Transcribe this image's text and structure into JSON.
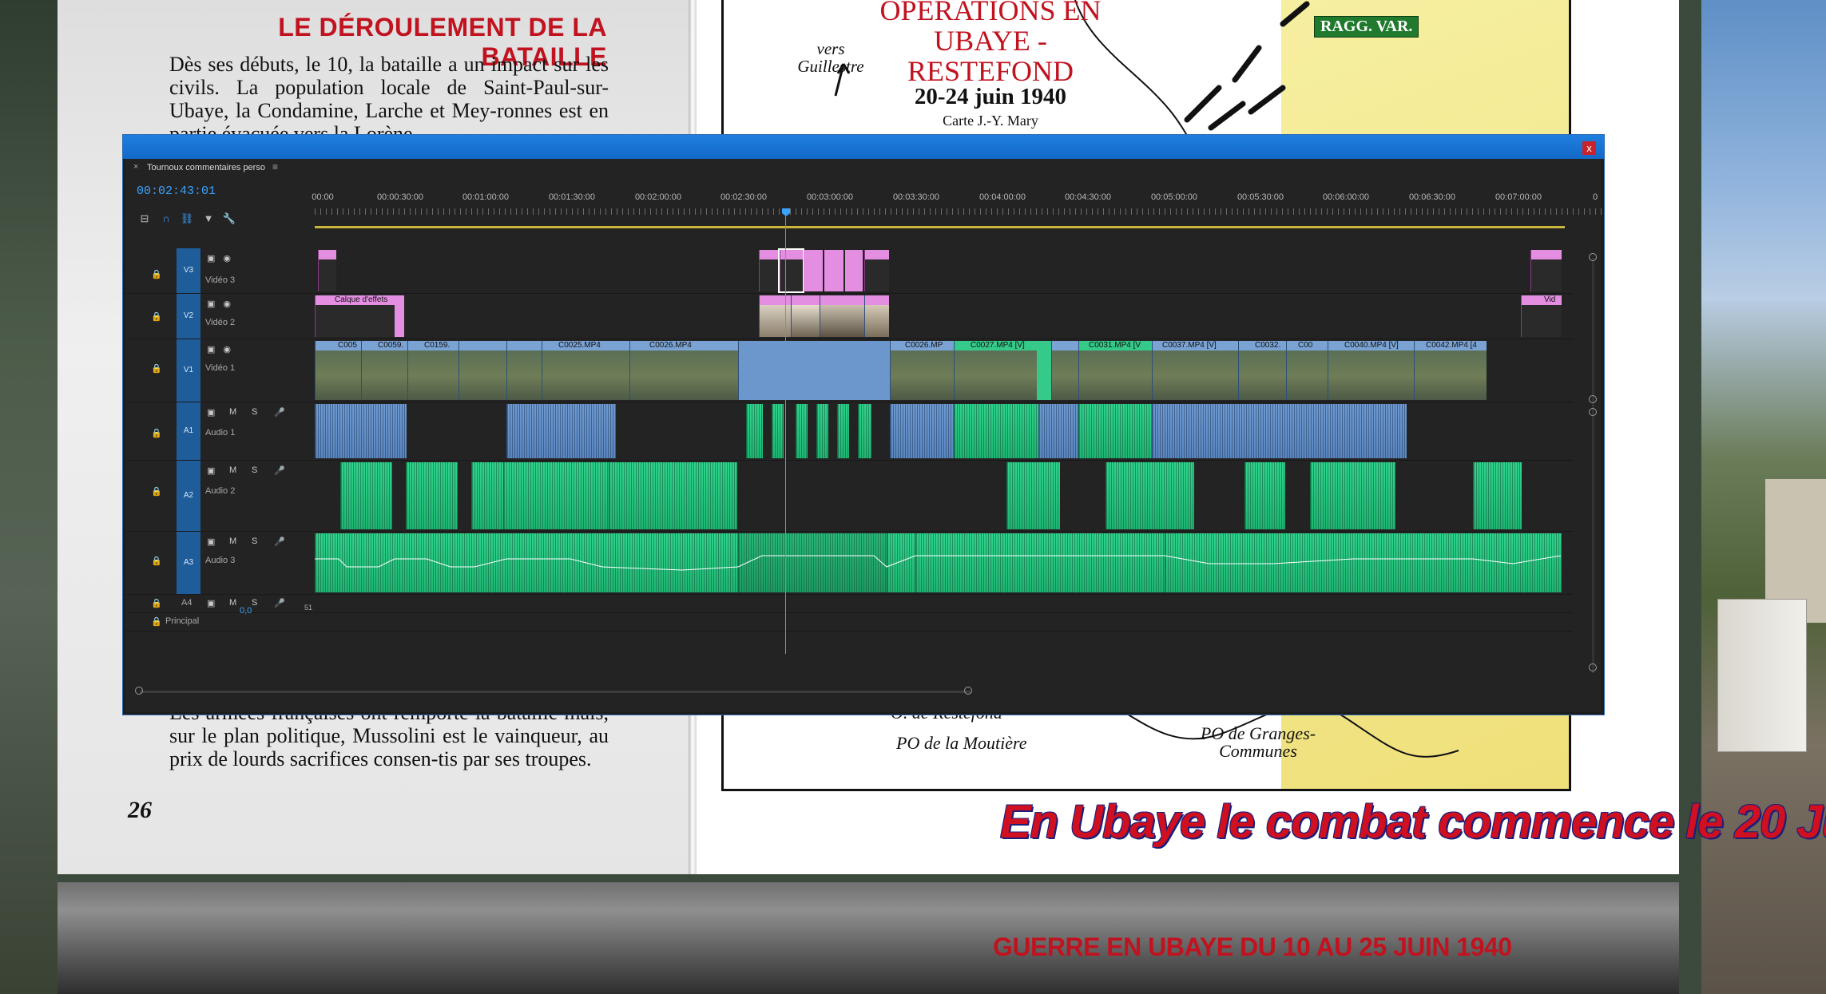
{
  "book": {
    "heading": "LE DÉROULEMENT DE LA BATAILLE",
    "paragraph_top": "Dès ses débuts, le 10, la bataille a un impact sur les civils. La population locale de Saint-Paul-sur-Ubaye, la Condamine, Larche et Mey-ronnes est en partie évacuée vers la Lorène",
    "paragraph_bottom": "Les armées françaises ont remporté la bataille mais, sur le plan politique, Mussolini est le vainqueur, au prix de lourds sacrifices consen-tis par ses troupes.",
    "page_number": "26",
    "map_title": "OPÉRATIONS EN UBAYE - RESTEFOND",
    "map_date": "20-24 juin 1940",
    "map_credit": "Carte J.-Y. Mary",
    "map_vers": "vers Guillestre",
    "map_ragg": "RAGG. VAR.",
    "map_label_restefond": "O. de Restefond",
    "map_label_moutiere": "PO de la Moutière",
    "map_label_granges": "PO de Granges-Communes",
    "caption": "En Ubaye le combat commence le 20 Ju",
    "bottom_title": "GUERRE EN UBAYE DU 10 AU 25 JUIN 1940"
  },
  "premiere": {
    "close_label": "x",
    "tab_close": "×",
    "sequence_name": "Tournoux commentaires perso",
    "tab_menu": "≡",
    "timecode": "00:02:43:01",
    "ruler_labels": [
      "00:00",
      "00:00:30:00",
      "00:01:00:00",
      "00:01:30:00",
      "00:02:00:00",
      "00:02:30:00",
      "00:03:00:00",
      "00:03:30:00",
      "00:04:00:00",
      "00:04:30:00",
      "00:05:00:00",
      "00:05:30:00",
      "00:06:00:00",
      "00:06:30:00",
      "00:07:00:00",
      "0"
    ],
    "tracks": [
      {
        "id": "V3",
        "name": "Vidéo 3",
        "kind": "video"
      },
      {
        "id": "V2",
        "name": "Vidéo 2",
        "kind": "video"
      },
      {
        "id": "V1",
        "name": "Vidéo 1",
        "kind": "video"
      },
      {
        "id": "A1",
        "name": "Audio 1",
        "kind": "audio"
      },
      {
        "id": "A2",
        "name": "Audio 2",
        "kind": "audio"
      },
      {
        "id": "A3",
        "name": "Audio 3",
        "kind": "audio"
      },
      {
        "id": "A4",
        "name": "",
        "kind": "audio"
      }
    ],
    "master_label": "Principal",
    "master_value": "0,0",
    "master_level": "51",
    "button_mute": "M",
    "button_solo": "S",
    "clip_labels": {
      "v2_effects": "Calque d'effets",
      "v2_end": "Vid",
      "v1": [
        "C005",
        "C0059.",
        "C0159.",
        "C0025.MP4",
        "C0026.MP4",
        "C0026.MP",
        "C0027.MP4 [V]",
        "C0031.MP4 [V",
        "C0037.MP4 [V]",
        "C0032.",
        "C00",
        "C0040.MP4 [V]",
        "C0042.MP4 [4"
      ]
    },
    "colors": {
      "accent": "#3aa3ff",
      "video_clip": "#7aa3d4",
      "adjust_clip": "#e38ee0",
      "audio_clip": "#2fd48d",
      "titlebar": "#1f7ee0"
    }
  }
}
